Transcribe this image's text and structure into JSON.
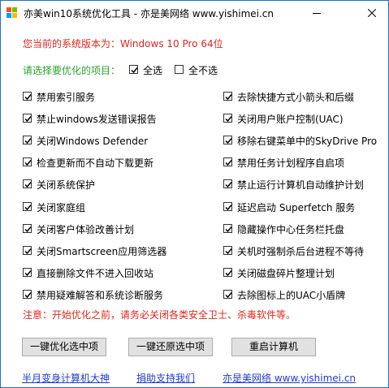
{
  "window": {
    "title": "亦美win10系统优化工具 - 亦是美网络 www.yishimei.cn",
    "minimize_icon": "minimize-icon",
    "close_icon": "close-icon"
  },
  "version_text": "您当前的系统版本为：Windows 10 Pro  64位",
  "select_prompt": "请选择要优化的项目：",
  "select_all": {
    "label": "全选",
    "checked": true
  },
  "select_none": {
    "label": "全不选",
    "checked": false
  },
  "options_left": [
    {
      "label": "禁用索引服务",
      "checked": true
    },
    {
      "label": "禁止windows发送错误报告",
      "checked": true
    },
    {
      "label": "关闭Windows Defender",
      "checked": true
    },
    {
      "label": "检查更新而不自动下载更新",
      "checked": true
    },
    {
      "label": "关闭系统保护",
      "checked": true
    },
    {
      "label": "关闭家庭组",
      "checked": true
    },
    {
      "label": "关闭客户体验改善计划",
      "checked": true
    },
    {
      "label": "关闭Smartscreen应用筛选器",
      "checked": true
    },
    {
      "label": "直接删除文件不进入回收站",
      "checked": true
    },
    {
      "label": "禁用疑难解答和系统诊断服务",
      "checked": true
    }
  ],
  "options_right": [
    {
      "label": "去除快捷方式小箭头和后缀",
      "checked": true
    },
    {
      "label": "关闭用户账户控制(UAC)",
      "checked": true
    },
    {
      "label": "移除右键菜单中的SkyDrive Pro",
      "checked": true
    },
    {
      "label": "禁用任务计划程序自启项",
      "checked": true
    },
    {
      "label": "禁止运行计算机自动维护计划",
      "checked": true
    },
    {
      "label": "延迟启动 Superfetch 服务",
      "checked": true
    },
    {
      "label": "隐藏操作中心任务栏托盘",
      "checked": true
    },
    {
      "label": "关机时强制杀后台进程不等待",
      "checked": true
    },
    {
      "label": "关闭磁盘碎片整理计划",
      "checked": true
    },
    {
      "label": "去除图标上的UAC小盾牌",
      "checked": true
    }
  ],
  "notice": "注意：开始优化之前，请务必关闭各类安全卫士、杀毒软件等。",
  "buttons": {
    "optimize": "一键优化选中项",
    "restore": "一键还原选中项",
    "restart": "重启计算机"
  },
  "links": {
    "author": "半月变身计算机大神",
    "donate": "捐助支持我们",
    "site": "亦是美网络 www.yishimei.cn"
  },
  "colors": {
    "accent_red": "#e1251b",
    "prompt_green": "#2aa52a",
    "link_blue": "#1d3bd6",
    "border_blue": "#1a73c9"
  }
}
